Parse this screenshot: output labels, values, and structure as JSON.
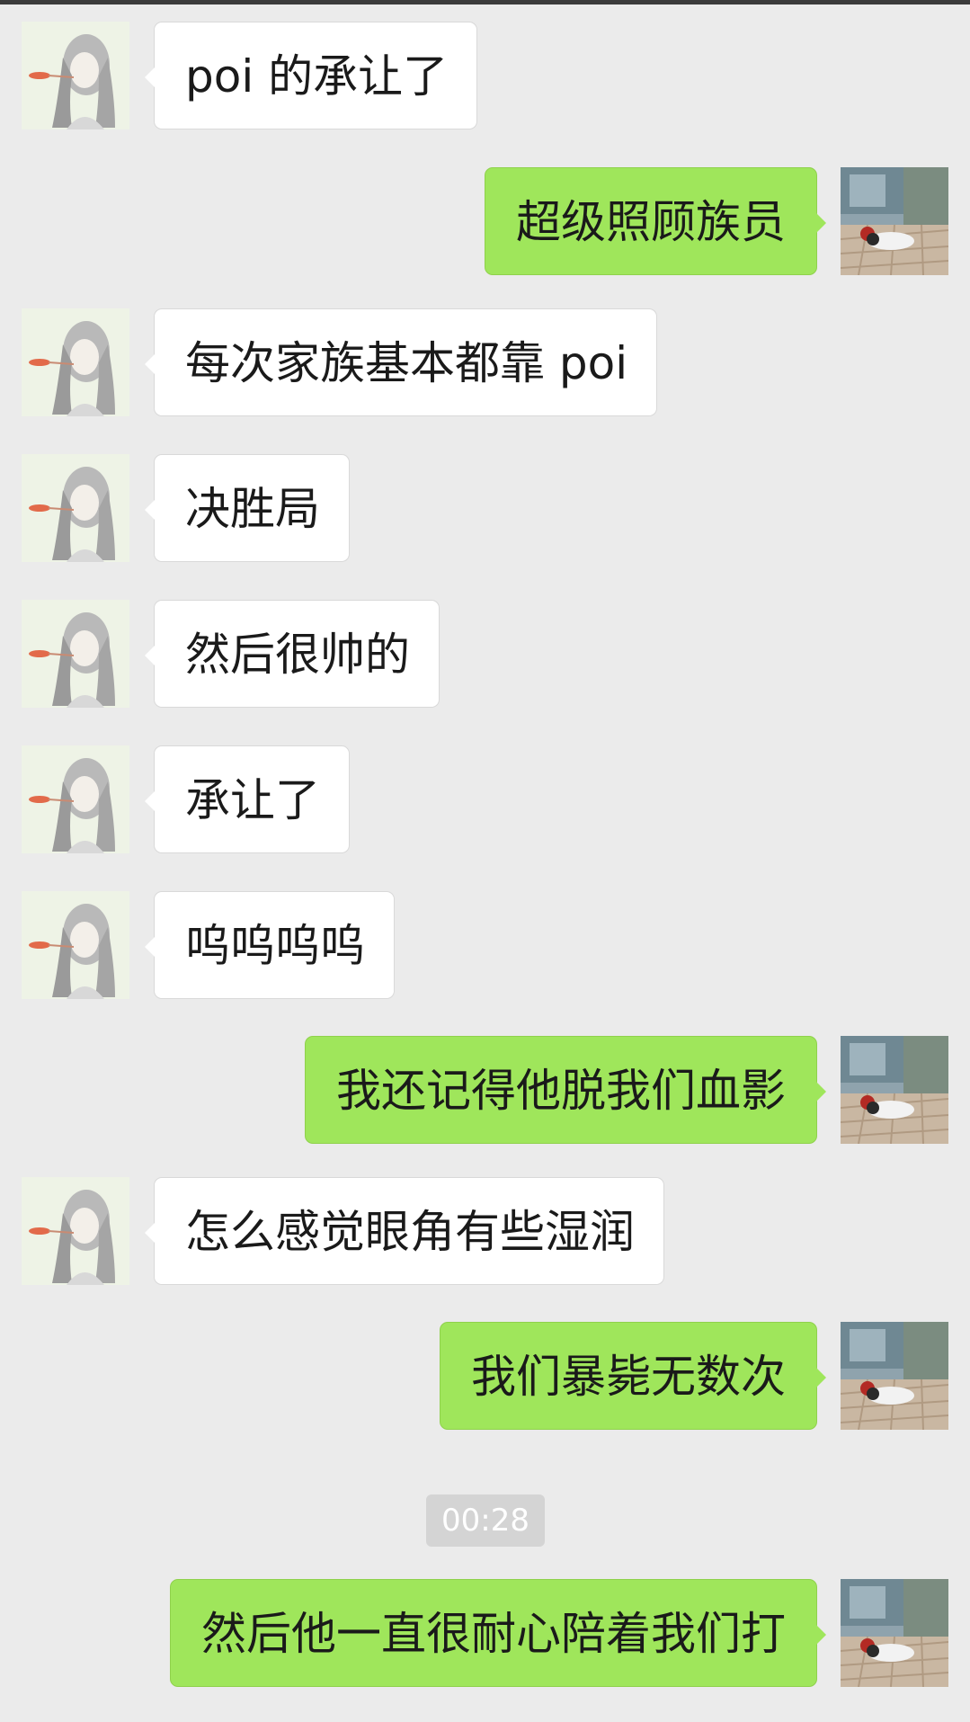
{
  "chat": {
    "messages": [
      {
        "side": "in",
        "text": "poi 的承让了"
      },
      {
        "side": "out",
        "text": "超级照顾族员"
      },
      {
        "side": "in",
        "text": "每次家族基本都靠 poi"
      },
      {
        "side": "in",
        "text": "决胜局"
      },
      {
        "side": "in",
        "text": "然后很帅的"
      },
      {
        "side": "in",
        "text": "承让了"
      },
      {
        "side": "in",
        "text": "呜呜呜呜"
      },
      {
        "side": "out",
        "text": "我还记得他脱我们血影"
      },
      {
        "side": "in",
        "text": "怎么感觉眼角有些湿润"
      },
      {
        "side": "out",
        "text": "我们暴毙无数次"
      },
      {
        "side": "out",
        "text": "然后他一直很耐心陪着我们打"
      }
    ],
    "timestamp": "00:28"
  },
  "colors": {
    "background": "#ebebeb",
    "incoming_bubble": "#ffffff",
    "outgoing_bubble": "#9fe65b",
    "timestamp_pill": "#d4d4d4"
  },
  "icons": {
    "contact_avatar": "sketch-girl-avatar",
    "self_avatar": "cat-photo-avatar"
  }
}
